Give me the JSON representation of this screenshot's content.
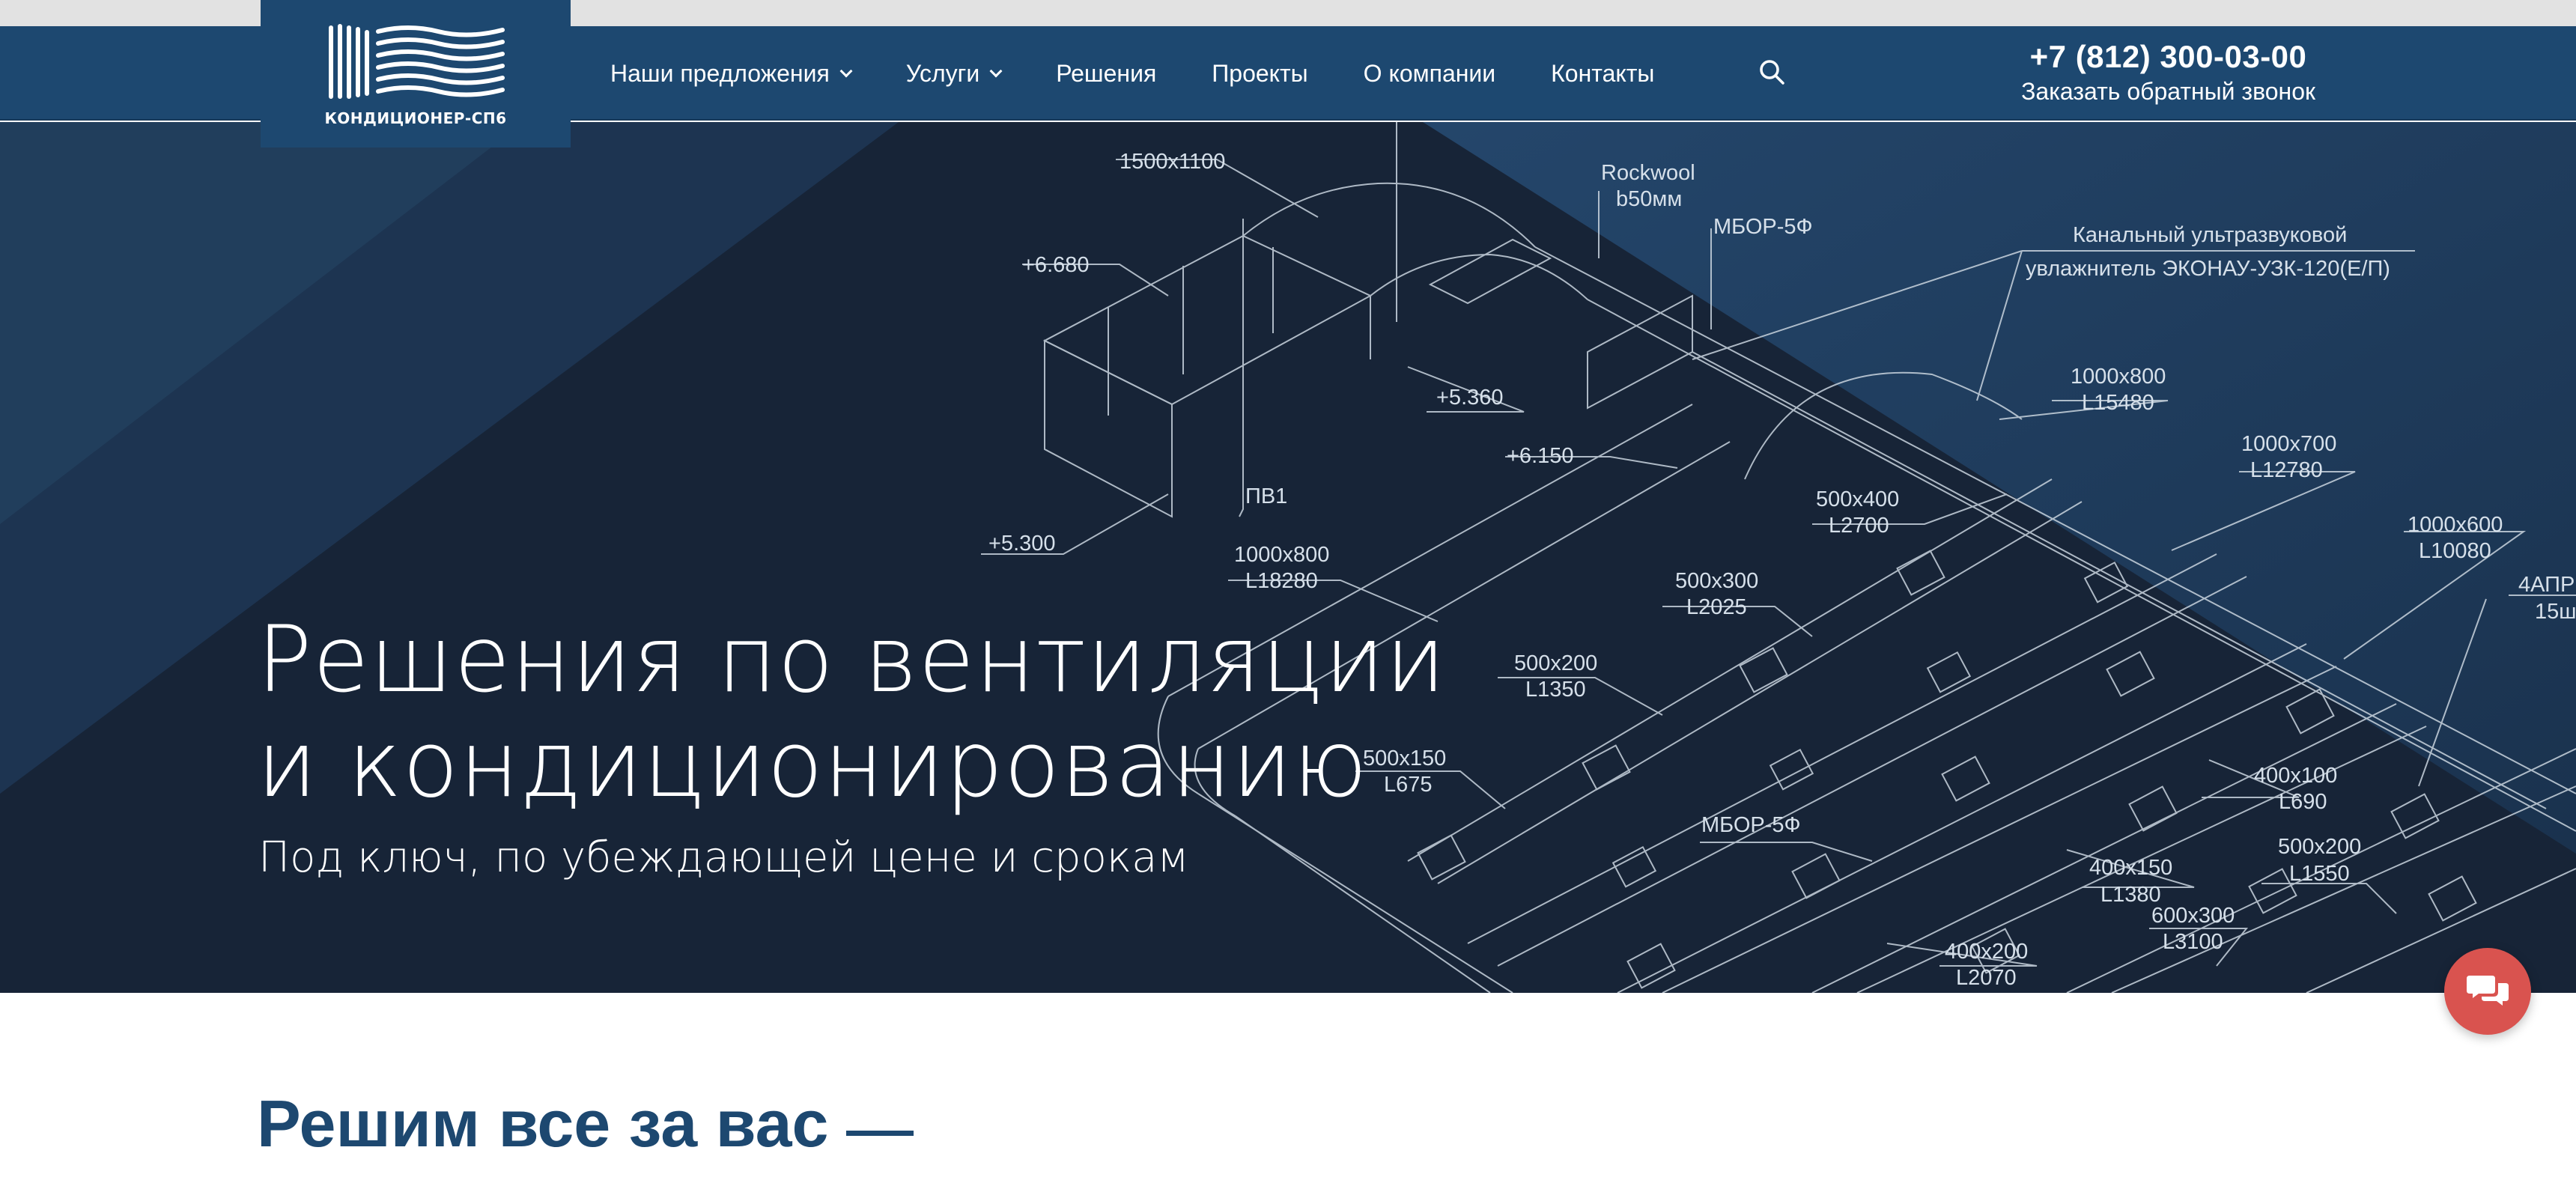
{
  "logo": {
    "text": "КОНДИЦИОНЕР-СП6",
    "icon": "waves-logo-icon"
  },
  "nav": {
    "items": [
      {
        "label": "Наши предложения",
        "has_dropdown": true
      },
      {
        "label": "Услуги",
        "has_dropdown": true
      },
      {
        "label": "Решения",
        "has_dropdown": false
      },
      {
        "label": "Проекты",
        "has_dropdown": false
      },
      {
        "label": "О компании",
        "has_dropdown": false
      },
      {
        "label": "Контакты",
        "has_dropdown": false
      }
    ],
    "search_icon": "search-icon"
  },
  "contact": {
    "phone": "+7 (812) 300-03-00",
    "callback": "Заказать обратный звонок"
  },
  "hero": {
    "title_line1": "Решения по вентиляции",
    "title_line2": "и кондиционированию",
    "subtitle": "Под ключ, по убеждающей цене и срокам"
  },
  "blueprint_labels": {
    "l1": "1500x1100",
    "l2": "+6.680",
    "l3": "Rockwool",
    "l4": "b50мм",
    "l5": "МБОР-5Ф",
    "l6": "Канальный ультразвуковой",
    "l7": "увлажнитель ЭКОНАУ-УЗК-120(Е/П)",
    "l8": "+5.360",
    "l9": "1000x800",
    "l10": "L15480",
    "l11": "+6.150",
    "l12": "1000x700",
    "l13": "L12780",
    "l14": "ПВ1",
    "l15": "500x400",
    "l16": "L2700",
    "l17": "+5.300",
    "l18": "1000x800",
    "l19": "L18280",
    "l20": "1000x600",
    "l21": "L10080",
    "l22": "500x300",
    "l23": "L2025",
    "l24": "4АПР",
    "l25": "15ш",
    "l26": "500x200",
    "l27": "L1350",
    "l28": "500x150",
    "l29": "L675",
    "l30": "400x100",
    "l31": "L690",
    "l32": "МБОР-5Ф",
    "l33": "500x200",
    "l34": "L1550",
    "l35": "400x150",
    "l36": "L1380",
    "l37": "600x300",
    "l38": "L3100",
    "l39": "400x200",
    "l40": "L2070"
  },
  "chat": {
    "icon": "chat-bubbles-icon"
  },
  "section": {
    "heading": "Решим все за вас"
  },
  "colors": {
    "header": "#1d4870",
    "hero_dark": "#172437",
    "accent_chat": "#d9534f",
    "heading": "#1d4870"
  }
}
